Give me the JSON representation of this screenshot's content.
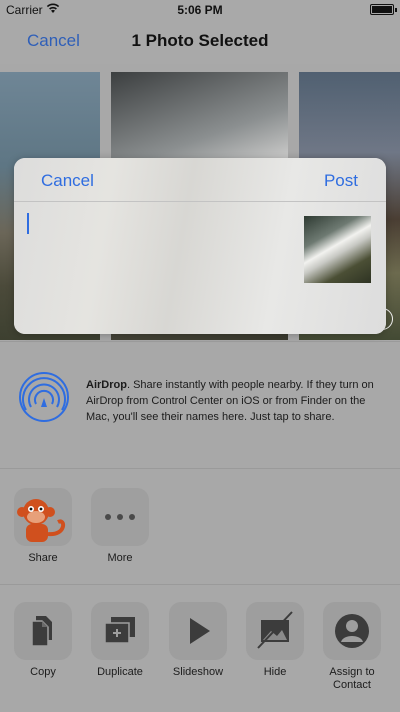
{
  "status_bar": {
    "carrier": "Carrier",
    "time": "5:06 PM"
  },
  "nav": {
    "cancel_label": "Cancel",
    "title": "1 Photo Selected"
  },
  "compose": {
    "cancel_label": "Cancel",
    "post_label": "Post",
    "text_value": ""
  },
  "airdrop": {
    "title": "AirDrop",
    "description": ". Share instantly with people nearby. If they turn on AirDrop from Control Center on iOS or from Finder on the Mac, you'll see their names here. Just tap to share."
  },
  "apps": [
    {
      "label": "Share",
      "icon": "monkey-icon"
    },
    {
      "label": "More",
      "icon": "more-dots-icon"
    }
  ],
  "actions": [
    {
      "label": "Copy",
      "icon": "copy-icon"
    },
    {
      "label": "Duplicate",
      "icon": "duplicate-icon"
    },
    {
      "label": "Slideshow",
      "icon": "play-icon"
    },
    {
      "label": "Hide",
      "icon": "hide-icon"
    },
    {
      "label": "Assign to Contact",
      "icon": "contact-icon"
    }
  ],
  "colors": {
    "link": "#2f6de0",
    "nav_link": "#2f5fb8",
    "monkey": "#d0501e"
  }
}
